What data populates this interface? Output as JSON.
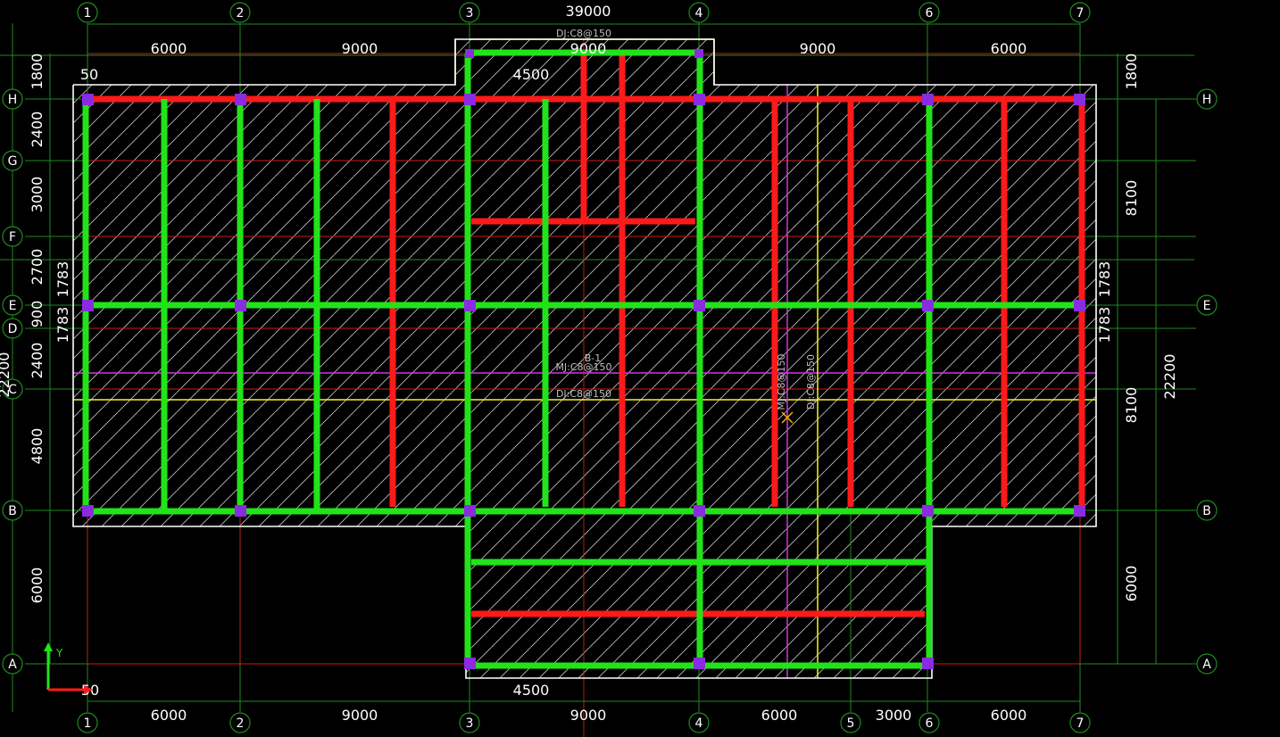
{
  "view": {
    "grid_columns": [
      "1",
      "2",
      "3",
      "4",
      "5",
      "6",
      "7"
    ],
    "grid_rows": [
      "A",
      "B",
      "C",
      "D",
      "E",
      "F",
      "G",
      "H"
    ],
    "dims_top": {
      "overall": "39000",
      "bays": [
        "6000",
        "9000",
        "9000",
        "6000"
      ],
      "bump_width": "9000",
      "bump_half": "4500",
      "offset": "50",
      "left_projection": "1800",
      "right_projection": "1800"
    },
    "dims_bottom": {
      "bays": [
        "6000",
        "9000",
        "9000",
        "6000",
        "3000",
        "6000"
      ],
      "half": "4500",
      "offset": "50"
    },
    "dims_left": {
      "spans": [
        "1800",
        "2400",
        "3000",
        "2700",
        "900",
        "2400",
        "4800",
        "6000"
      ],
      "small": [
        "1783",
        "1783"
      ],
      "total_clipped": "22200"
    },
    "dims_right": {
      "spans": [
        "1800",
        "8100",
        "8100",
        "6000"
      ],
      "small": [
        "1783",
        "1783"
      ],
      "total": "22200"
    },
    "labels": {
      "slab_tag": "B-1",
      "dj_top": "DJ:C8@150",
      "mj_horizontal": "MJ:C8@150",
      "dj_horizontal": "DJ:C8@150",
      "mj_vertical": "MJ:C8@150",
      "dj_vertical": "DJ:C8@150"
    },
    "ucs": {
      "y_label": "Y"
    },
    "colors": {
      "background": "#000000",
      "beam_green": "#22e31a",
      "beam_red": "#ff1a1a",
      "grid_line": "#1f8a1f",
      "column": "#8a2be2",
      "outline": "#ffffff",
      "magenta_line": "#d233e0",
      "yellow_line": "#f5f22a",
      "marker": "#ffb400"
    }
  }
}
